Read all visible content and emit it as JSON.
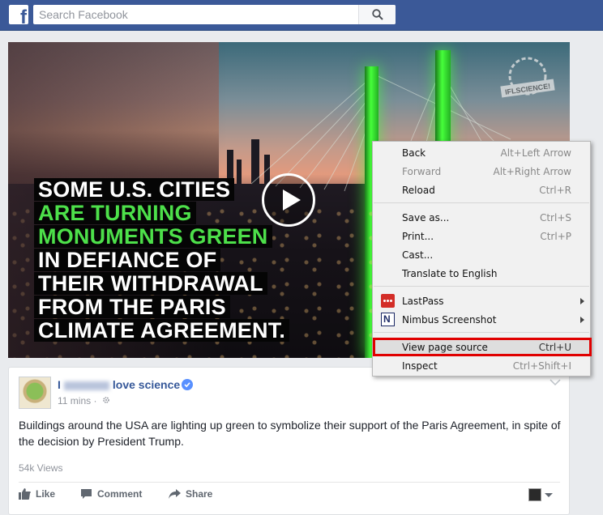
{
  "colors": {
    "brand": "#3b5998",
    "highlight_border": "#e00000",
    "headline_green": "#4de04a",
    "link": "#365899"
  },
  "topbar": {
    "logo_letter": "f",
    "search_placeholder": "Search Facebook",
    "search_icon": "magnifier-icon"
  },
  "video": {
    "headline_lines": [
      {
        "text": "SOME U.S. CITIES",
        "color": "white"
      },
      {
        "text": "ARE TURNING",
        "color": "green"
      },
      {
        "text": "MONUMENTS GREEN",
        "color": "green"
      },
      {
        "text": "IN DEFIANCE OF",
        "color": "white"
      },
      {
        "text": "THEIR WITHDRAWAL",
        "color": "white"
      },
      {
        "text": "FROM THE PARIS",
        "color": "white"
      },
      {
        "text": "CLIMATE AGREEMENT.",
        "color": "white"
      }
    ],
    "play_icon": "play-icon",
    "watermark_text": "IFLSCIENCE!"
  },
  "post": {
    "page_name_start": "I",
    "page_name_end": "love science",
    "time": "11 mins",
    "separator": "·",
    "text": "Buildings around the USA are lighting up green to symbolize their support of the Paris Agreement, in spite of the decision by President Trump.",
    "views": "54k Views",
    "actions": {
      "like": "Like",
      "comment": "Comment",
      "share": "Share"
    }
  },
  "context_menu": {
    "items": [
      {
        "label": "Back",
        "shortcut": "Alt+Left Arrow",
        "disabled": false
      },
      {
        "label": "Forward",
        "shortcut": "Alt+Right Arrow",
        "disabled": true
      },
      {
        "label": "Reload",
        "shortcut": "Ctrl+R",
        "disabled": false
      },
      {
        "label": "Save as...",
        "shortcut": "Ctrl+S",
        "disabled": false
      },
      {
        "label": "Print...",
        "shortcut": "Ctrl+P",
        "disabled": false
      },
      {
        "label": "Cast...",
        "shortcut": "",
        "disabled": false
      },
      {
        "label": "Translate to English",
        "shortcut": "",
        "disabled": false
      },
      {
        "label": "LastPass",
        "shortcut": "",
        "disabled": false
      },
      {
        "label": "Nimbus Screenshot",
        "shortcut": "",
        "disabled": false
      },
      {
        "label": "View page source",
        "shortcut": "Ctrl+U",
        "disabled": false
      },
      {
        "label": "Inspect",
        "shortcut": "Ctrl+Shift+I",
        "disabled": false
      }
    ],
    "nimbus_icon_letter": "N"
  }
}
